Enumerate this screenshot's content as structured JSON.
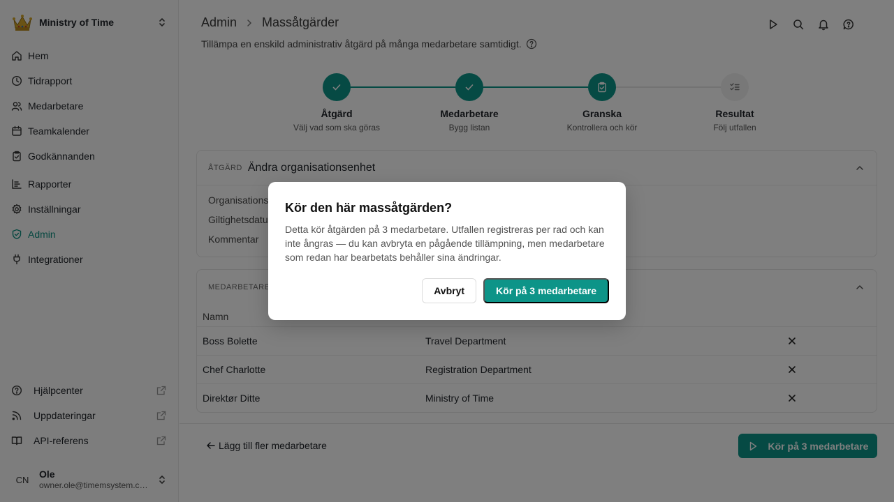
{
  "sidebar": {
    "org_name": "Ministry of Time",
    "nav": [
      {
        "label": "Hem",
        "icon": "home-icon"
      },
      {
        "label": "Tidrapport",
        "icon": "clock-icon"
      },
      {
        "label": "Medarbetare",
        "icon": "users-icon"
      },
      {
        "label": "Teamkalender",
        "icon": "calendar-icon"
      },
      {
        "label": "Godkännanden",
        "icon": "clipboard-check-icon"
      },
      {
        "label": "Rapporter",
        "icon": "chart-icon"
      },
      {
        "label": "Inställningar",
        "icon": "gear-icon"
      },
      {
        "label": "Admin",
        "icon": "shield-icon",
        "active": true
      },
      {
        "label": "Integrationer",
        "icon": "plug-icon"
      }
    ],
    "footer": [
      {
        "label": "Hjälpcenter",
        "icon": "help-circle-icon"
      },
      {
        "label": "Uppdateringar",
        "icon": "rss-icon"
      },
      {
        "label": "API-referens",
        "icon": "book-icon"
      }
    ],
    "user": {
      "initials": "CN",
      "name": "Ole",
      "email": "owner.ole@timemsystem.com"
    }
  },
  "header": {
    "breadcrumb_root": "Admin",
    "breadcrumb_current": "Massåtgärder",
    "subtitle": "Tillämpa en enskild administrativ åtgärd på många medarbetare samtidigt."
  },
  "steps": [
    {
      "title": "Åtgärd",
      "subtitle": "Välj vad som ska göras",
      "state": "done"
    },
    {
      "title": "Medarbetare",
      "subtitle": "Bygg listan",
      "state": "done"
    },
    {
      "title": "Granska",
      "subtitle": "Kontrollera och kör",
      "state": "current"
    },
    {
      "title": "Resultat",
      "subtitle": "Följ utfallen",
      "state": "pending"
    }
  ],
  "action_card": {
    "kicker": "Åtgärd",
    "title": "Ändra organisationsenhet",
    "fields": [
      "Organisationsenhet",
      "Giltighetsdatum",
      "Kommentar"
    ]
  },
  "employees_card": {
    "kicker": "Medarbetare",
    "column_name": "Namn",
    "rows": [
      {
        "name": "Boss Bolette",
        "unit": "Travel Department"
      },
      {
        "name": "Chef Charlotte",
        "unit": "Registration Department"
      },
      {
        "name": "Direktør Ditte",
        "unit": "Ministry of Time"
      }
    ]
  },
  "footer_bar": {
    "back_label": "Lägg till fler medarbetare",
    "run_label": "Kör på 3 medarbetare"
  },
  "dialog": {
    "title": "Kör den här massåtgärden?",
    "body": "Detta kör åtgärden på 3 medarbetare. Utfallen registreras per rad och kan inte ångras — du kan avbryta en pågående tillämpning, men medarbetare som redan har bearbetats behåller sina ändringar.",
    "cancel_label": "Avbryt",
    "confirm_label": "Kör på 3 medarbetare"
  },
  "colors": {
    "accent": "#0d9488",
    "active_nav": "#0a8f80"
  }
}
